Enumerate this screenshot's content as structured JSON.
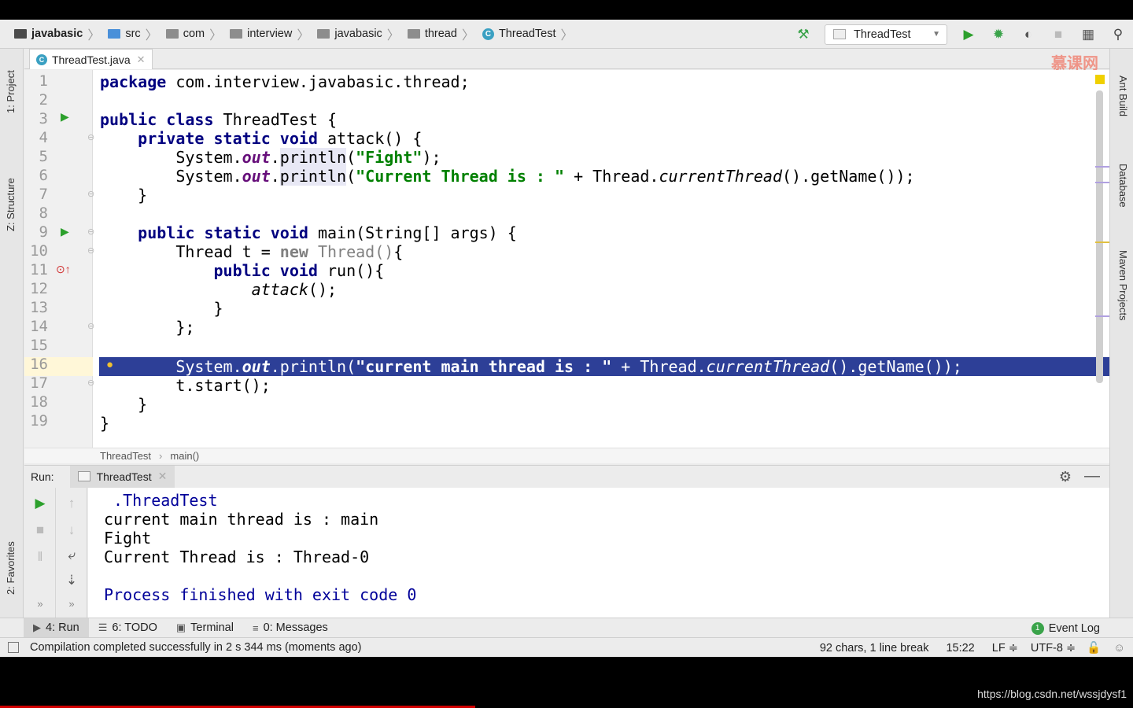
{
  "breadcrumbs": [
    "javabasic",
    "src",
    "com",
    "interview",
    "javabasic",
    "thread",
    "ThreadTest"
  ],
  "toolbar": {
    "run_config": "ThreadTest",
    "icons": [
      "hammer-icon",
      "run-icon",
      "debug-icon",
      "coverage-icon",
      "stop-icon",
      "sdk-icon",
      "search-icon"
    ]
  },
  "left_tools": [
    "1: Project",
    "Z: Structure",
    "2: Favorites"
  ],
  "right_tools": [
    "Ant Build",
    "Database",
    "Maven Projects"
  ],
  "editor": {
    "tab": "ThreadTest.java",
    "watermark": "慕课网",
    "line_numbers": [
      "1",
      "2",
      "3",
      "4",
      "5",
      "6",
      "7",
      "8",
      "9",
      "10",
      "11",
      "12",
      "13",
      "14",
      "15",
      "16",
      "17",
      "18",
      "19"
    ],
    "current_line": "15",
    "code": {
      "l1_kw": "package",
      "l1_rest": " com.interview.javabasic.thread;",
      "l3_kw": "public class",
      "l3_rest": " ThreadTest {",
      "l4_kw": "    private static void",
      "l4_rest": " attack() {",
      "l5_a": "        System.",
      "l5_out": "out",
      "l5_b": ".",
      "l5_println": "println",
      "l5_c": "(",
      "l5_str": "\"Fight\"",
      "l5_d": ");",
      "l6_a": "        System.",
      "l6_out": "out",
      "l6_b": ".",
      "l6_println": "println",
      "l6_c": "(",
      "l6_str": "\"Current Thread is : \"",
      "l6_d": " + Thread.",
      "l6_ct": "currentThread",
      "l6_e": "().getName());",
      "l7": "    }",
      "l9_kw": "    public static void",
      "l9_rest": " main(String[] args) {",
      "l10_a": "        Thread t = ",
      "l10_new": "new",
      "l10_b": " ",
      "l10_thread": "Thread()",
      "l10_c": "{",
      "l11_kw": "            public void",
      "l11_rest": " run(){",
      "l12_a": "                ",
      "l12_attack": "attack",
      "l12_b": "();",
      "l13": "            }",
      "l14": "        };",
      "l15_a": "        System.",
      "l15_out": "out",
      "l15_b": ".println(",
      "l15_str": "\"current main thread is : \"",
      "l15_c": " + Thread.",
      "l15_ct": "currentThread",
      "l15_d": "().getName());",
      "l16": "        t.start();",
      "l17": "    }",
      "l18": "}"
    },
    "breadcrumb": [
      "ThreadTest",
      "main()"
    ]
  },
  "run_panel": {
    "label": "Run:",
    "tab": "ThreadTest",
    "output": [
      " .ThreadTest",
      "current main thread is : main",
      "Fight",
      "Current Thread is : Thread-0",
      "",
      "Process finished with exit code 0"
    ]
  },
  "tool_tabs": [
    {
      "label": "4: Run"
    },
    {
      "label": "6: TODO"
    },
    {
      "label": "Terminal"
    },
    {
      "label": "0: Messages"
    }
  ],
  "event_log": "Event Log",
  "status": {
    "message": "Compilation completed successfully in 2 s 344 ms (moments ago)",
    "chars": "92 chars, 1 line break",
    "position": "15:22",
    "line_sep": "LF ≑",
    "encoding": "UTF-8 ≑"
  },
  "video_url": "https://blog.csdn.net/wssjdysf1",
  "colors": {
    "keyword": "#000080",
    "string": "#008000",
    "field": "#660e7a",
    "highlight": "#2d3f97",
    "process_text": "#000099"
  }
}
